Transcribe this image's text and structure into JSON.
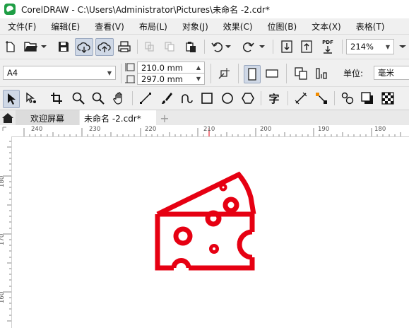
{
  "window": {
    "title": "CorelDRAW - C:\\Users\\Administrator\\Pictures\\未命名 -2.cdr*"
  },
  "menu": [
    "文件(F)",
    "编辑(E)",
    "查看(V)",
    "布局(L)",
    "对象(J)",
    "效果(C)",
    "位图(B)",
    "文本(X)",
    "表格(T)"
  ],
  "standard_toolbar": {
    "zoom_value": "214%",
    "icons": [
      "new-document-icon",
      "open-folder-icon",
      "save-icon",
      "cloud-download-icon",
      "cloud-upload-icon",
      "print-icon",
      "cut-icon",
      "copy-icon",
      "paste-icon",
      "undo-icon",
      "redo-icon",
      "import-icon",
      "export-icon",
      "publish-pdf-icon"
    ],
    "pdf_label": "PDF"
  },
  "property_bar": {
    "page_size": "A4",
    "width": "210.0 mm",
    "height": "297.0 mm",
    "units_label": "单位:",
    "units_value": "毫米"
  },
  "toolbox": {
    "icons": [
      "pick-tool-icon",
      "shape-tool-icon",
      "crop-tool-icon",
      "zoom-tool-icon",
      "pan-tool-icon",
      "freehand-tool-icon",
      "artistic-media-icon",
      "rectangle-tool-icon",
      "ellipse-tool-icon",
      "polygon-tool-icon",
      "text-tool-icon",
      "parallel-dimension-icon",
      "connector-tool-icon",
      "blend-tool-icon",
      "drop-shadow-icon",
      "transparency-icon"
    ],
    "text_tool_glyph": "字"
  },
  "tabs": {
    "welcome": "欢迎屏幕",
    "document": "未命名 -2.cdr*",
    "add": "+"
  },
  "rulers": {
    "horizontal": [
      "240",
      "230",
      "220",
      "210",
      "200",
      "190",
      "180"
    ],
    "vertical": [
      "180",
      "170",
      "160"
    ]
  },
  "artwork": {
    "subject": "cheese-icon",
    "color": "#e60012"
  }
}
